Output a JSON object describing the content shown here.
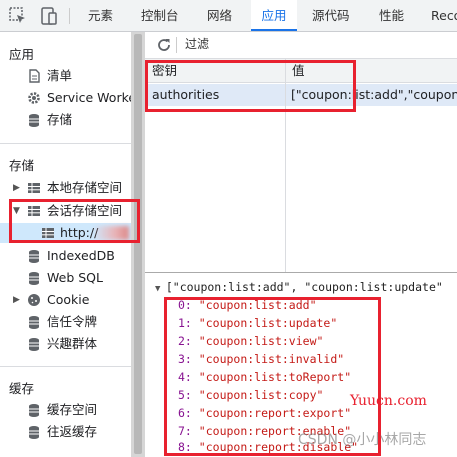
{
  "tabs": [
    "元素",
    "控制台",
    "网络",
    "应用",
    "源代码",
    "性能",
    "Reco"
  ],
  "sidebar": {
    "app_section": "应用",
    "app_items": [
      "清单",
      "Service Workers",
      "存储"
    ],
    "storage_section": "存储",
    "storage_items": [
      "本地存储空间",
      "会话存储空间",
      "http://",
      "IndexedDB",
      "Web SQL",
      "Cookie",
      "信任令牌",
      "兴趣群体"
    ],
    "cache_section": "缓存",
    "cache_items": [
      "缓存空间",
      "往返缓存"
    ]
  },
  "toolbar": {
    "filter_placeholder": "过滤"
  },
  "table": {
    "headers": [
      "密钥",
      "值"
    ],
    "rows": [
      {
        "key": "authorities",
        "value": "[\"coupon:list:add\",\"coupon:list:update\""
      }
    ]
  },
  "detail": {
    "header": "[\"coupon:list:add\", \"coupon:list:update\"",
    "items": [
      {
        "index": "0:",
        "value": "\"coupon:list:add\""
      },
      {
        "index": "1:",
        "value": "\"coupon:list:update\""
      },
      {
        "index": "2:",
        "value": "\"coupon:list:view\""
      },
      {
        "index": "3:",
        "value": "\"coupon:list:invalid\""
      },
      {
        "index": "4:",
        "value": "\"coupon:list:toReport\""
      },
      {
        "index": "5:",
        "value": "\"coupon:list:copy\""
      },
      {
        "index": "6:",
        "value": "\"coupon:report:export\""
      },
      {
        "index": "7:",
        "value": "\"coupon:report:enable\""
      },
      {
        "index": "8:",
        "value": "\"coupon:report:disable\""
      }
    ]
  },
  "watermarks": {
    "site": "Yuucn.com",
    "author": "CSDN @小小林同志"
  },
  "colors": {
    "accent": "#1a73e8",
    "highlight": "#e8212f",
    "index": "#881391",
    "string": "#c41a16"
  }
}
